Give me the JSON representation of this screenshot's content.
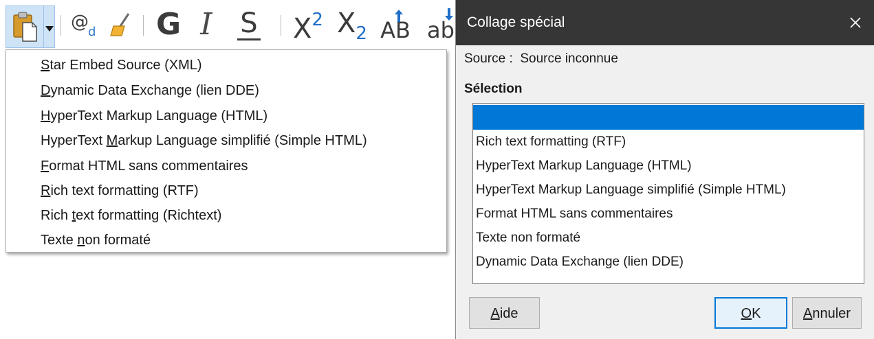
{
  "toolbar": {
    "bold": "G",
    "italic": "I",
    "strike": "S",
    "superscript_base": "X",
    "superscript_exp": "2",
    "subscript_base": "X",
    "subscript_exp": "2",
    "uppercase": "AB",
    "lowercase": "ab"
  },
  "paste_menu": {
    "items": [
      {
        "pre": "",
        "key": "S",
        "post": "tar Embed Source (XML)"
      },
      {
        "pre": "",
        "key": "D",
        "post": "ynamic Data Exchange (lien DDE)"
      },
      {
        "pre": "",
        "key": "H",
        "post": "yperText Markup Language (HTML)"
      },
      {
        "pre": "HyperText ",
        "key": "M",
        "post": "arkup Language simplifié (Simple HTML)"
      },
      {
        "pre": "",
        "key": "F",
        "post": "ormat HTML sans commentaires"
      },
      {
        "pre": "",
        "key": "R",
        "post": "ich text formatting (RTF)"
      },
      {
        "pre": "Rich ",
        "key": "t",
        "post": "ext formatting (Richtext)"
      },
      {
        "pre": "Texte ",
        "key": "n",
        "post": "on formaté"
      }
    ]
  },
  "dialog": {
    "title": "Collage spécial",
    "source_label": "Source :",
    "source_value": "Source inconnue",
    "selection_label": "Sélection",
    "list_items": [
      "",
      "Rich text formatting (RTF)",
      "HyperText Markup Language (HTML)",
      "HyperText Markup Language simplifié (Simple HTML)",
      "Format HTML sans commentaires",
      "Texte non formaté",
      "Dynamic Data Exchange (lien DDE)"
    ],
    "selected_index": 0,
    "buttons": {
      "help": {
        "key": "A",
        "rest": "ide"
      },
      "ok": {
        "key": "O",
        "rest": "K"
      },
      "cancel": {
        "key": "A",
        "rest": "nnuler"
      }
    }
  },
  "colors": {
    "selection": "#0078d7",
    "titlebar": "#363636",
    "paste_button_bg": "#cfe3f7"
  }
}
